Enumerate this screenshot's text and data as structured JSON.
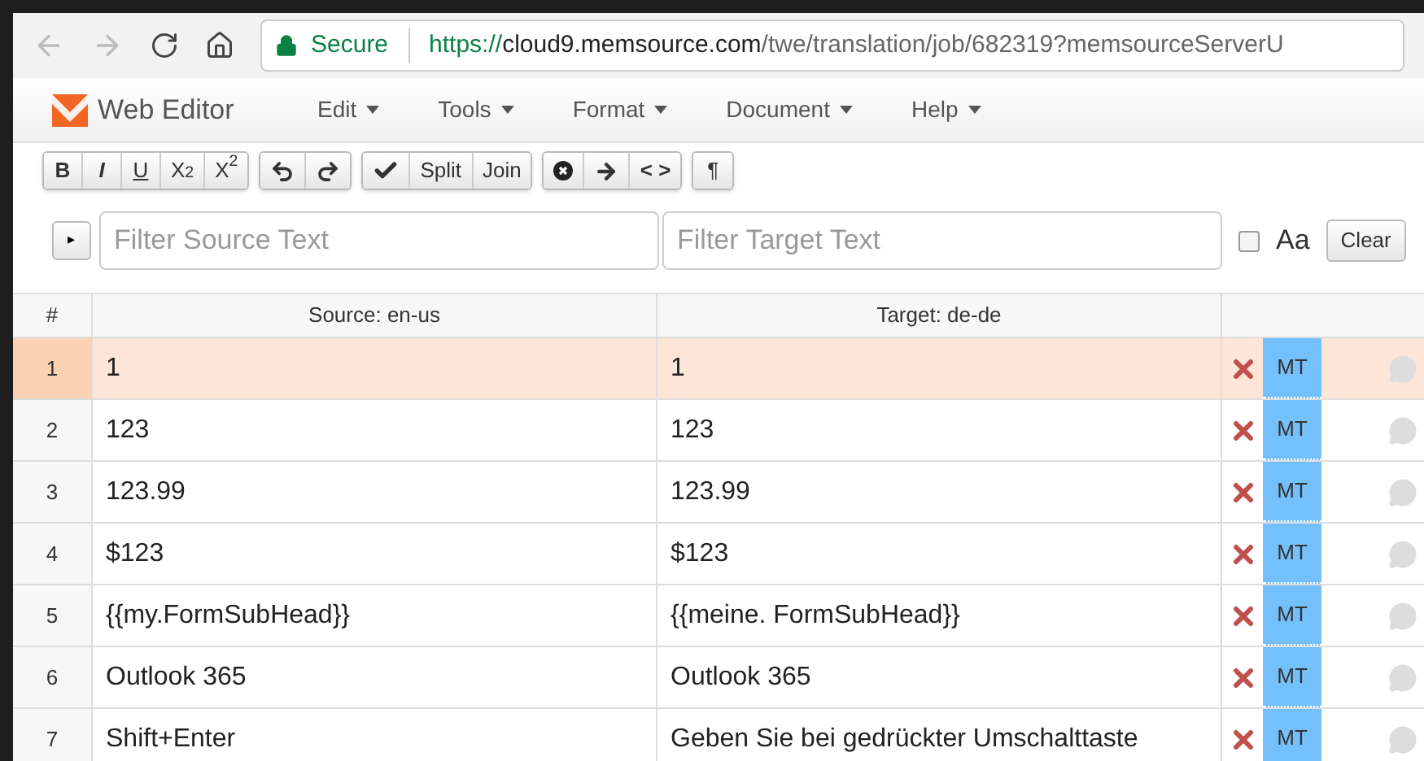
{
  "browser": {
    "secure_label": "Secure",
    "url_scheme": "https://",
    "url_host": "cloud9.memsource.com",
    "url_path": "/twe/translation/job/682319?memsourceServerU"
  },
  "app": {
    "title": "Web Editor"
  },
  "menu": [
    "Edit",
    "Tools",
    "Format",
    "Document",
    "Help"
  ],
  "toolbar": [
    {
      "buttons": [
        {
          "kind": "bold",
          "label": "B"
        },
        {
          "kind": "italic",
          "label": "I"
        },
        {
          "kind": "underline",
          "label": "U"
        },
        {
          "kind": "sub",
          "label": "X",
          "script": "2"
        },
        {
          "kind": "sup",
          "label": "X",
          "script": "2"
        }
      ]
    },
    {
      "buttons": [
        {
          "kind": "undo"
        },
        {
          "kind": "redo"
        }
      ]
    },
    {
      "buttons": [
        {
          "kind": "confirm"
        },
        {
          "kind": "text",
          "label": "Split"
        },
        {
          "kind": "text",
          "label": "Join"
        }
      ]
    },
    {
      "buttons": [
        {
          "kind": "clear"
        },
        {
          "kind": "copy"
        },
        {
          "kind": "tags",
          "label": "< >"
        }
      ]
    },
    {
      "buttons": [
        {
          "kind": "text",
          "label": "¶"
        }
      ]
    }
  ],
  "filter": {
    "expand": "▸",
    "source_placeholder": "Filter Source Text",
    "target_placeholder": "Filter Target Text",
    "match_case_checked": false,
    "match_case_label": "Aa",
    "clear": "Clear"
  },
  "table": {
    "columns": [
      "#",
      "Source: en-us",
      "Target: de-de"
    ],
    "rows": [
      {
        "num": "1",
        "source": "1",
        "target": "1",
        "badge": "MT",
        "selected": true
      },
      {
        "num": "2",
        "source": "123",
        "target": "123",
        "badge": "MT",
        "selected": false
      },
      {
        "num": "3",
        "source": "123.99",
        "target": "123.99",
        "badge": "MT",
        "selected": false
      },
      {
        "num": "4",
        "source": "$123",
        "target": "$123",
        "badge": "MT",
        "selected": false
      },
      {
        "num": "5",
        "source": "{{my.FormSubHead}}",
        "target": "{{meine. FormSubHead}}",
        "badge": "MT",
        "selected": false
      },
      {
        "num": "6",
        "source": "Outlook 365",
        "target": "Outlook 365",
        "badge": "MT",
        "selected": false
      },
      {
        "num": "7",
        "source": "Shift+Enter",
        "target": "Geben Sie bei gedrückter Umschalttaste",
        "badge": "MT",
        "selected": false
      }
    ]
  }
}
